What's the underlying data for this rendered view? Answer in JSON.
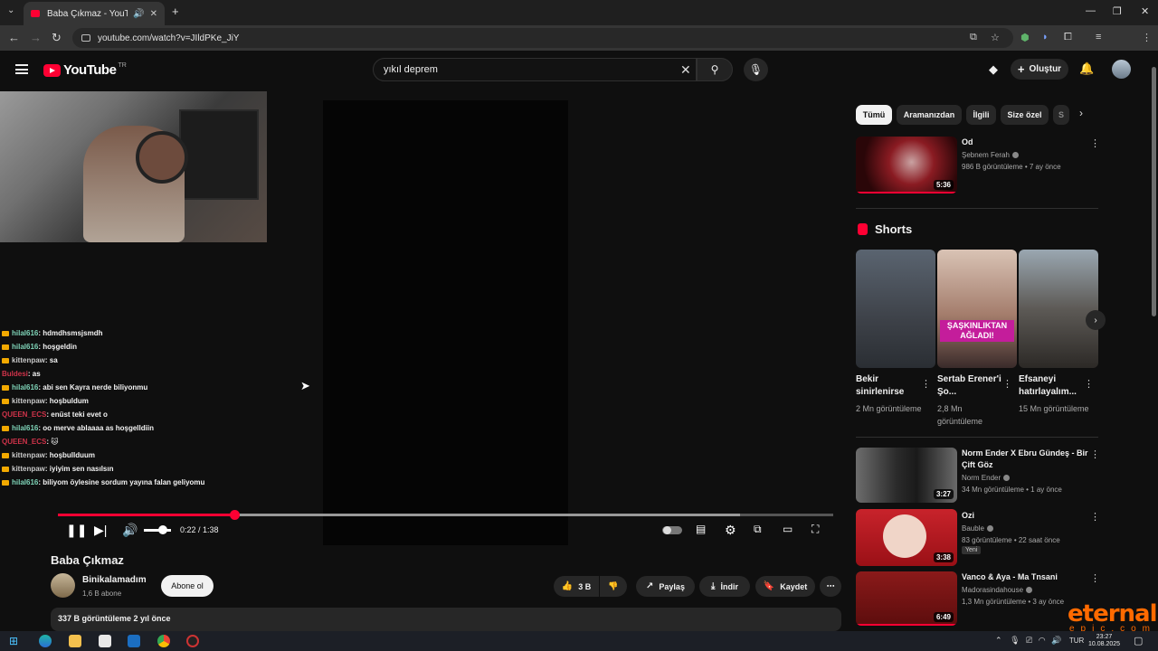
{
  "browser": {
    "tab_title": "Baba Çıkmaz - YouTube",
    "url": "youtube.com/watch?v=JIldPKe_JiY",
    "accent": "#ff0033"
  },
  "masthead": {
    "logo_text": "YouTube",
    "country": "TR",
    "search_query": "yıkıl deprem",
    "create_label": "Oluştur"
  },
  "player": {
    "time": "0:22 / 1:38",
    "progress_fraction": 0.228,
    "buffered_fraction": 0.88,
    "volume_fraction": 0.7
  },
  "chat": [
    {
      "user": "hilal616",
      "msg": " : hdmdhsmsjsmdh",
      "color": "#7fd4b8",
      "badge": true
    },
    {
      "user": "hilal616",
      "msg": " : hoşgeldin",
      "color": "#7fd4b8",
      "badge": true
    },
    {
      "user": "kittenpaw",
      "msg": " : sa",
      "color": "#c8c8c8",
      "badge": true
    },
    {
      "user": "Buldesi",
      "msg": " : as",
      "color": "#d0334a",
      "badge": false
    },
    {
      "user": "hilal616",
      "msg": " : abi sen Kayra nerde biliyonmu",
      "color": "#7fd4b8",
      "badge": true
    },
    {
      "user": "kittenpaw",
      "msg": " : hoşbuldum",
      "color": "#c8c8c8",
      "badge": true
    },
    {
      "user": "QUEEN_ECS",
      "msg": " : enüst teki evet o",
      "color": "#d0334a",
      "badge": false
    },
    {
      "user": "hilal616",
      "msg": " : oo merve ablaaaa as hoşgelldiin",
      "color": "#7fd4b8",
      "badge": true
    },
    {
      "user": "QUEEN_ECS",
      "msg": " : 🐱",
      "color": "#d0334a",
      "badge": false
    },
    {
      "user": "kittenpaw",
      "msg": " : hoşbullduum",
      "color": "#c8c8c8",
      "badge": true
    },
    {
      "user": "kittenpaw",
      "msg": " : iyiyim sen nasılsın",
      "color": "#c8c8c8",
      "badge": true
    },
    {
      "user": "hilal616",
      "msg": " : biliyom öylesine sordum yayına falan geliyomu",
      "color": "#7fd4b8",
      "badge": true
    }
  ],
  "video": {
    "title": "Baba Çıkmaz",
    "channel": "Binikalamadım",
    "subs": "1,6 B abone",
    "subscribe_label": "Abone ol",
    "likes": "3 B",
    "share_label": "Paylaş",
    "download_label": "İndir",
    "save_label": "Kaydet",
    "views_date": "337 B görüntüleme  2 yıl önce"
  },
  "chips": [
    "Tümü",
    "Aramanızdan",
    "İlgili",
    "Size özel",
    "S"
  ],
  "recommended_top": {
    "title": "Od",
    "channel": "Şebnem Ferah",
    "meta": "986 B görüntüleme • 7 ay önce",
    "duration": "5:36"
  },
  "shorts": {
    "heading": "Shorts",
    "items": [
      {
        "title": "Bekir sinirlenirse",
        "views": "2 Mn görüntüleme"
      },
      {
        "title": "Sertab Erener'i Şo...",
        "views": "2,8 Mn görüntüleme"
      },
      {
        "title": "Efsaneyi hatırlayalım...",
        "views": "15 Mn görüntüleme"
      }
    ],
    "overlay_text": "ŞAŞKINLIKTAN AĞLADI!"
  },
  "recommended": [
    {
      "title": "Norm Ender X Ebru Gündeş - Bir Çift Göz",
      "channel": "Norm Ender",
      "meta": "34 Mn görüntüleme • 1 ay önce",
      "duration": "3:27"
    },
    {
      "title": "Ozi",
      "channel": "Bauble",
      "meta": "83 görüntüleme • 22 saat önce",
      "duration": "3:38",
      "badge": "Yeni"
    },
    {
      "title": "Vanco & Aya - Ma Tnsani",
      "channel": "Madorasindahouse",
      "meta": "1,3 Mn görüntüleme • 3 ay önce",
      "duration": "6:49"
    }
  ],
  "taskbar": {
    "lang": "TUR",
    "time": "23:27",
    "date": "10.08.2025"
  },
  "watermark": {
    "main": "eternal",
    "sub": "epic.com"
  }
}
